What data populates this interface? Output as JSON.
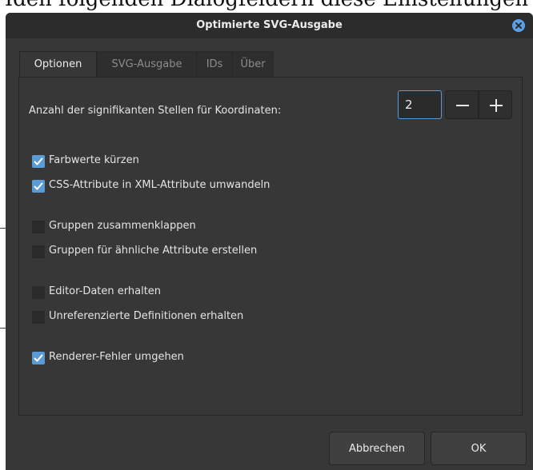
{
  "background": {
    "heading": "Iden folgenden Dialogfeldern diese Einstellungen"
  },
  "dialog": {
    "title": "Optimierte SVG-Ausgabe"
  },
  "tabs": [
    {
      "label": "Optionen",
      "active": true
    },
    {
      "label": "SVG-Ausgabe",
      "active": false
    },
    {
      "label": "IDs",
      "active": false
    },
    {
      "label": "Über",
      "active": false
    }
  ],
  "options": {
    "coordinate_label": "Anzahl der signifikanten Stellen für Koordinaten:",
    "coordinate_value": "2",
    "items": [
      {
        "label": "Farbwerte kürzen",
        "checked": true
      },
      {
        "label": "CSS-Attribute in XML-Attribute umwandeln",
        "checked": true
      },
      {
        "label": "Gruppen zusammenklappen",
        "checked": false
      },
      {
        "label": "Gruppen für ähnliche Attribute erstellen",
        "checked": false
      },
      {
        "label": "Editor-Daten erhalten",
        "checked": false
      },
      {
        "label": "Unreferenzierte Definitionen erhalten",
        "checked": false
      },
      {
        "label": "Renderer-Fehler umgehen",
        "checked": true
      }
    ]
  },
  "buttons": {
    "cancel": "Abbrechen",
    "ok": "OK"
  },
  "colors": {
    "accent": "#5b9bd5",
    "dialog_bg": "#373737",
    "titlebar_bg": "#2c2c2c"
  }
}
